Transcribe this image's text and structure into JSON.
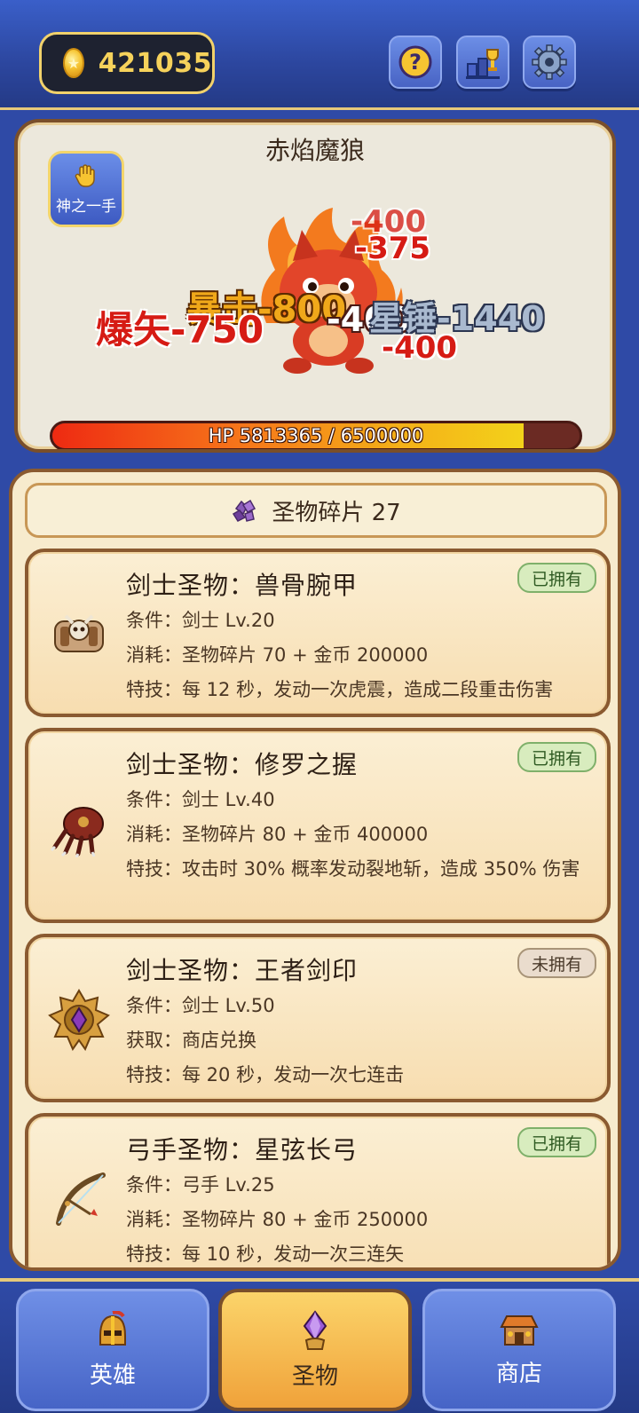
{
  "header": {
    "coins": "421035",
    "icons": [
      "help-icon",
      "leaderboard-icon",
      "settings-icon"
    ]
  },
  "boss": {
    "name": "赤焰魔狼",
    "skill_label": "神之一手",
    "hp_text": "HP 5813365 / 6500000",
    "hp_fraction": 0.894,
    "damage_texts": [
      "-400",
      "-375",
      "暴击-800",
      "爆矢-750",
      "-400",
      "星锤-1440",
      "-400"
    ]
  },
  "relics": {
    "shard_label": "圣物碎片 27",
    "items": [
      {
        "title": "剑士圣物：兽骨腕甲",
        "status": "已拥有",
        "line1": "条件：剑士 Lv.20",
        "line2": "消耗：圣物碎片 70 + 金币 200000",
        "line3": "特技：每 12 秒，发动一次虎震，造成二段重击伤害"
      },
      {
        "title": "剑士圣物：修罗之握",
        "status": "已拥有",
        "line1": "条件：剑士 Lv.40",
        "line2": "消耗：圣物碎片 80 + 金币 400000",
        "line3": "特技：攻击时 30% 概率发动裂地斩，造成 350% 伤害"
      },
      {
        "title": "剑士圣物：王者剑印",
        "status": "未拥有",
        "line1": "条件：剑士 Lv.50",
        "line2": "获取：商店兑换",
        "line3": "特技：每 20 秒，发动一次七连击"
      },
      {
        "title": "弓手圣物：星弦长弓",
        "status": "已拥有",
        "line1": "条件：弓手 Lv.25",
        "line2": "消耗：圣物碎片 80 + 金币 250000",
        "line3": "特技：每 10 秒，发动一次三连矢"
      }
    ]
  },
  "nav": {
    "heroes": "英雄",
    "relics": "圣物",
    "shop": "商店",
    "active": "relics"
  }
}
